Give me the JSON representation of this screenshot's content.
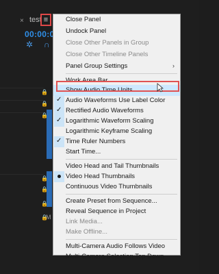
{
  "panel": {
    "tab_close": "×",
    "tab_title": "test",
    "menu_button_icon": "hamburger-menu-icon",
    "timecode": "00:00:0",
    "track_label": "M"
  },
  "menu": {
    "items": [
      {
        "label": "Close Panel",
        "state": "none",
        "enabled": true
      },
      {
        "label": "Undock Panel",
        "state": "none",
        "enabled": true
      },
      {
        "label": "Close Other Panels in Group",
        "state": "none",
        "enabled": false
      },
      {
        "label": "Close Other Timeline Panels",
        "state": "none",
        "enabled": false
      },
      {
        "label": "Panel Group Settings",
        "state": "submenu",
        "enabled": true
      },
      {
        "label": "Work Area Bar",
        "state": "none",
        "enabled": true
      },
      {
        "label": "Show Audio Time Units",
        "state": "none",
        "enabled": true,
        "highlighted": true
      },
      {
        "label": "Audio Waveforms Use Label Color",
        "state": "checked",
        "enabled": true
      },
      {
        "label": "Rectified Audio Waveforms",
        "state": "checked",
        "enabled": true
      },
      {
        "label": "Logarithmic Waveform Scaling",
        "state": "checked",
        "enabled": true
      },
      {
        "label": "Logarithmic Keyframe Scaling",
        "state": "none",
        "enabled": true
      },
      {
        "label": "Time Ruler Numbers",
        "state": "checked",
        "enabled": true
      },
      {
        "label": "Start Time...",
        "state": "none",
        "enabled": true
      },
      {
        "label": "Video Head and Tail Thumbnails",
        "state": "none",
        "enabled": true
      },
      {
        "label": "Video Head Thumbnails",
        "state": "selected",
        "enabled": true
      },
      {
        "label": "Continuous Video Thumbnails",
        "state": "none",
        "enabled": true
      },
      {
        "label": "Create Preset from Sequence...",
        "state": "none",
        "enabled": true
      },
      {
        "label": "Reveal Sequence in Project",
        "state": "none",
        "enabled": true
      },
      {
        "label": "Link Media...",
        "state": "none",
        "enabled": false
      },
      {
        "label": "Make Offline...",
        "state": "none",
        "enabled": false
      },
      {
        "label": "Multi-Camera Audio Follows Video",
        "state": "none",
        "enabled": true
      },
      {
        "label": "Multi-Camera Selection Top Down",
        "state": "none",
        "enabled": true
      }
    ],
    "check_glyph": "✓",
    "submenu_glyph": "›"
  },
  "colors": {
    "menu_bg": "#f0f0f0",
    "highlight_box": "#e05252",
    "timecode": "#2f8fe8",
    "check_bg": "#cce4f7"
  }
}
